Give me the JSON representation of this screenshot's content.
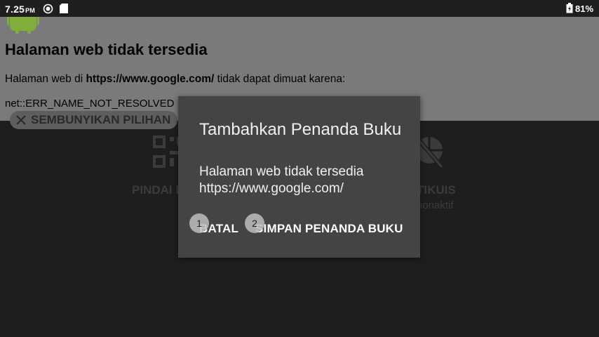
{
  "status_bar": {
    "time": "7.25",
    "ampm": "PM",
    "battery": "81%"
  },
  "page": {
    "title": "Halaman web tidak tersedia",
    "line_prefix": "Halaman web di ",
    "line_url": "https://www.google.com/",
    "line_suffix": " tidak dapat dimuat karena:",
    "error": "net::ERR_NAME_NOT_RESOLVED",
    "hide_options_label": "SEMBUNYIKAN PILIHAN"
  },
  "options": {
    "left_label": "PINDAI KODE QR",
    "right_label": "TIKUIS",
    "right_sub": "nonaktif"
  },
  "dialog": {
    "title": "Tambahkan Penanda Buku",
    "body_title": "Halaman web tidak tersedia",
    "body_url": "https://www.google.com/",
    "cancel_label": "BATAL",
    "save_label": "SIMPAN PENANDA BUKU"
  },
  "markers": [
    "1",
    "2"
  ],
  "colors": {
    "status_bar": "#1f1f1f",
    "dialog_bg": "#444444",
    "page_bg": "#7a7a7a",
    "android_green": "#7fae3a"
  },
  "icons": {
    "status_1": "sync-icon",
    "status_2": "sd-card-icon",
    "battery": "battery-icon",
    "android": "android-icon",
    "hide": "close-icon",
    "left_option": "qr-code-icon",
    "right_option": "mouse-off-icon"
  }
}
